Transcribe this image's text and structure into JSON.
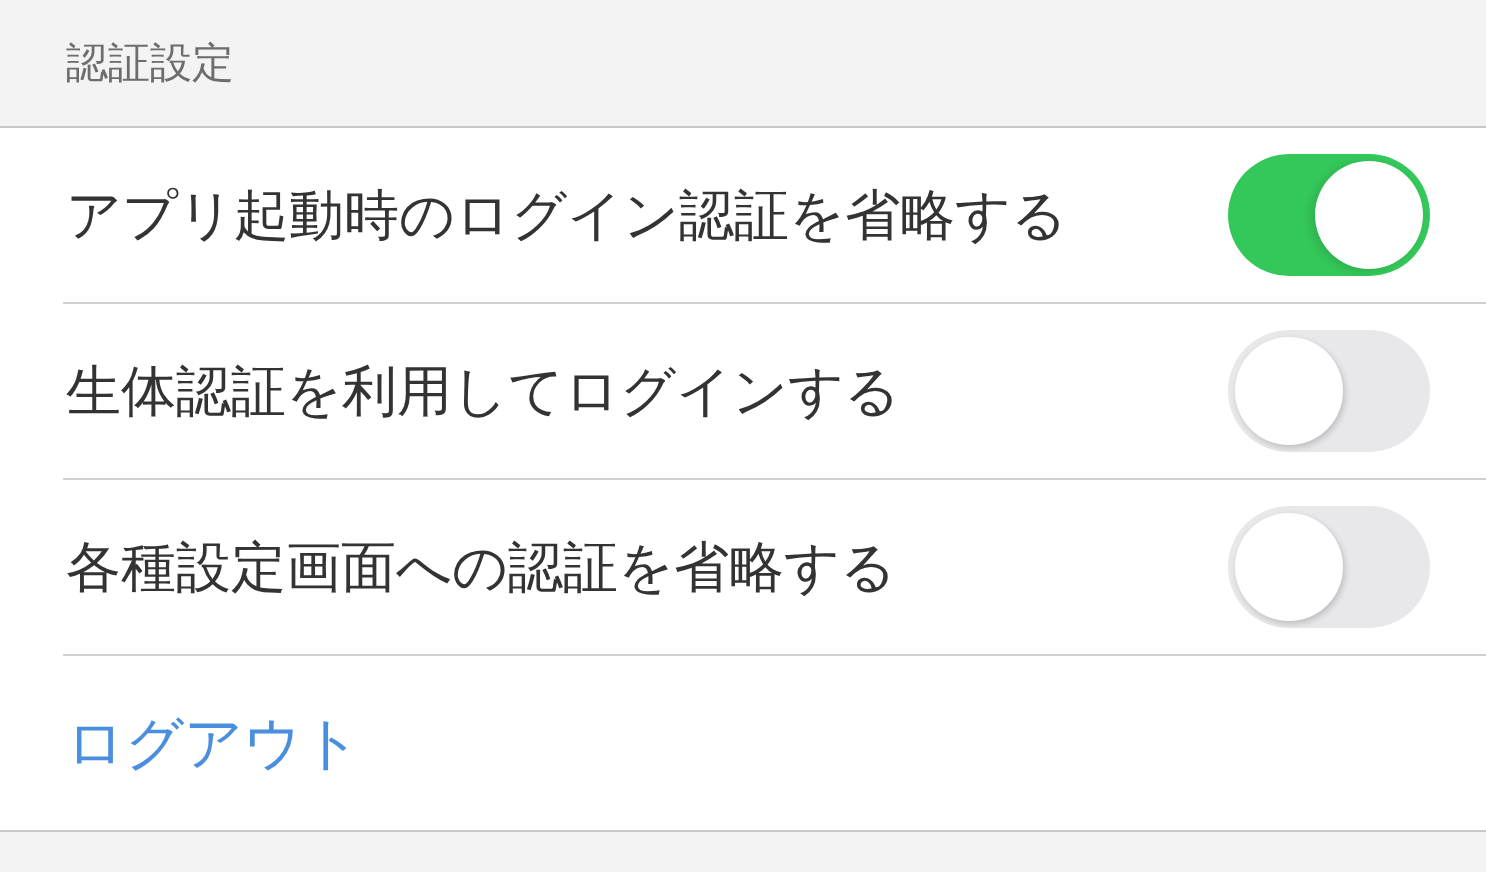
{
  "header": {
    "title": "認証設定"
  },
  "settings": [
    {
      "label": "アプリ起動時のログイン認証を省略する",
      "on": true
    },
    {
      "label": "生体認証を利用してログインする",
      "on": false
    },
    {
      "label": "各種設定画面への認証を省略する",
      "on": false
    }
  ],
  "logout": {
    "label": "ログアウト"
  }
}
